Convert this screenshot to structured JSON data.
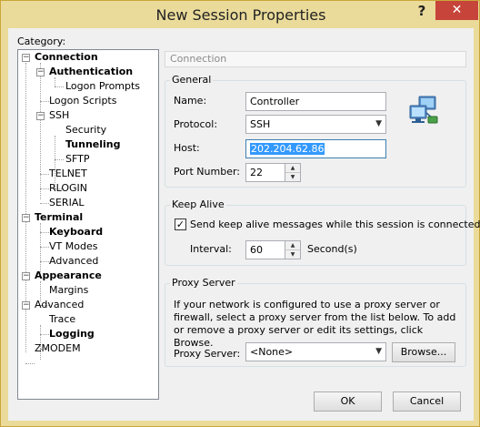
{
  "window": {
    "title": "New Session Properties",
    "help_label": "?",
    "close_label": "✕"
  },
  "category": {
    "label": "Category:",
    "tree": [
      {
        "label": "Connection",
        "bold": true,
        "expanded": true
      },
      {
        "label": "Authentication",
        "bold": true,
        "expanded": true
      },
      {
        "label": "Logon Prompts",
        "bold": false
      },
      {
        "label": "Logon Scripts",
        "bold": false
      },
      {
        "label": "SSH",
        "bold": false,
        "expanded": true
      },
      {
        "label": "Security",
        "bold": false
      },
      {
        "label": "Tunneling",
        "bold": true
      },
      {
        "label": "SFTP",
        "bold": false
      },
      {
        "label": "TELNET",
        "bold": false
      },
      {
        "label": "RLOGIN",
        "bold": false
      },
      {
        "label": "SERIAL",
        "bold": false
      },
      {
        "label": "Terminal",
        "bold": true,
        "expanded": true
      },
      {
        "label": "Keyboard",
        "bold": true
      },
      {
        "label": "VT Modes",
        "bold": false
      },
      {
        "label": "Advanced",
        "bold": false
      },
      {
        "label": "Appearance",
        "bold": true,
        "expanded": true
      },
      {
        "label": "Margins",
        "bold": false
      },
      {
        "label": "Advanced",
        "bold": false,
        "expanded": true
      },
      {
        "label": "Trace",
        "bold": false
      },
      {
        "label": "Logging",
        "bold": true
      },
      {
        "label": "ZMODEM",
        "bold": false
      }
    ]
  },
  "panel": {
    "header": "Connection",
    "general": {
      "title": "General",
      "name_label": "Name:",
      "name_value": "Controller",
      "protocol_label": "Protocol:",
      "protocol_value": "SSH",
      "host_label": "Host:",
      "host_value": "202.204.62.86",
      "port_label": "Port Number:",
      "port_value": "22",
      "icon": "network-computers-icon"
    },
    "keepalive": {
      "title": "Keep Alive",
      "checkbox_label": "Send keep alive messages while this session is connected",
      "checked": true,
      "interval_label": "Interval:",
      "interval_value": "60",
      "interval_unit": "Second(s)"
    },
    "proxy": {
      "title": "Proxy Server",
      "description": "If your network is configured to use a proxy server or firewall, select a proxy server from the list below. To add or remove a proxy server or edit its settings, click Browse.",
      "server_label": "Proxy Server:",
      "server_value": "<None>",
      "browse_label": "Browse..."
    }
  },
  "buttons": {
    "ok": "OK",
    "cancel": "Cancel"
  },
  "colors": {
    "title_bar": "#eadb9a",
    "close_button": "#c7443a",
    "selection": "#3399ff"
  }
}
